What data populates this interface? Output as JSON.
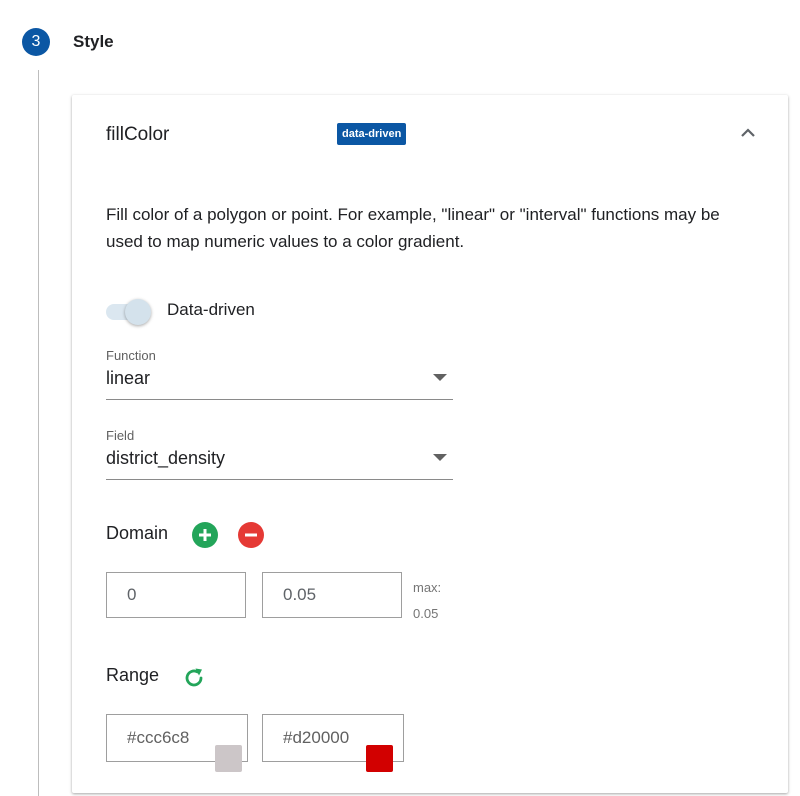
{
  "step": {
    "number": "3",
    "title": "Style"
  },
  "property": {
    "name": "fillColor",
    "badge": "data-driven",
    "description": "Fill color of a polygon or point. For example, \"linear\" or \"interval\" functions may be used to map numeric values to a color gradient."
  },
  "toggle": {
    "label": "Data-driven",
    "on": true
  },
  "function_select": {
    "label": "Function",
    "value": "linear"
  },
  "field_select": {
    "label": "Field",
    "value": "district_density"
  },
  "domain": {
    "label": "Domain",
    "values": [
      "0",
      "0.05"
    ],
    "max_label": "max:",
    "max_value": "0.05"
  },
  "range": {
    "label": "Range",
    "values": [
      "#ccc6c8",
      "#d20000"
    ]
  },
  "colors": {
    "accent": "#0b57a4",
    "add": "#23a55a",
    "remove": "#e53935",
    "refresh": "#23a55a"
  },
  "icons": {
    "collapse": "chevron-up-icon",
    "add": "plus-circle-icon",
    "remove": "minus-circle-icon",
    "refresh": "refresh-icon",
    "dropdown": "caret-down-icon"
  }
}
